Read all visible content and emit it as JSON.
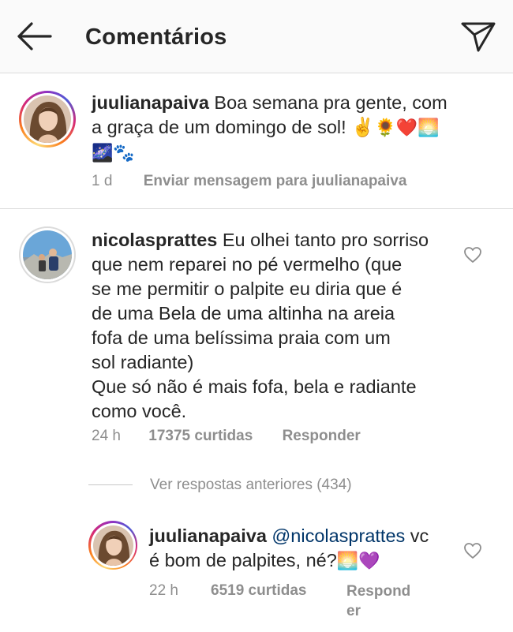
{
  "header": {
    "title": "Comentários",
    "back_icon": "arrow-left-icon",
    "send_icon": "paper-plane-icon"
  },
  "caption": {
    "username": "juulianapaiva",
    "text_line1": " Boa semana pra gente, com",
    "text_line2": "a graça de um domingo de sol! ✌️",
    "emojis_line2": "🌻❤️🌅",
    "emojis_line3": "🌌🐾",
    "time": "1 d",
    "send_message": "Enviar mensagem para juulianapaiva"
  },
  "comment": {
    "username": "nicolasprattes",
    "lines": [
      " Eu olhei tanto pro sorriso",
      "que nem reparei no pé vermelho (que",
      "se me permitir o palpite eu diria que é",
      "de uma Bela de uma altinha na areia",
      "fofa de uma belíssima praia com um",
      "sol radiante)",
      "Que só não é mais fofa, bela e radiante",
      "como você."
    ],
    "time": "24 h",
    "likes": "17375 curtidas",
    "reply": "Responder"
  },
  "view_replies": "Ver respostas anteriores (434)",
  "reply": {
    "username": "juulianapaiva",
    "mention": "@nicolasprattes",
    "text_line1_rest": " vc",
    "text_line2": "é bom de palpites, né?",
    "emojis": "🌅💜",
    "time": "22 h",
    "likes": "6519 curtidas",
    "reply_line1": "Respond",
    "reply_line2": "er"
  },
  "colors": {
    "text": "#262626",
    "meta": "#8e8e8e",
    "mention": "#003569",
    "divider": "#dbdbdb",
    "header_bg": "#fafafa"
  }
}
